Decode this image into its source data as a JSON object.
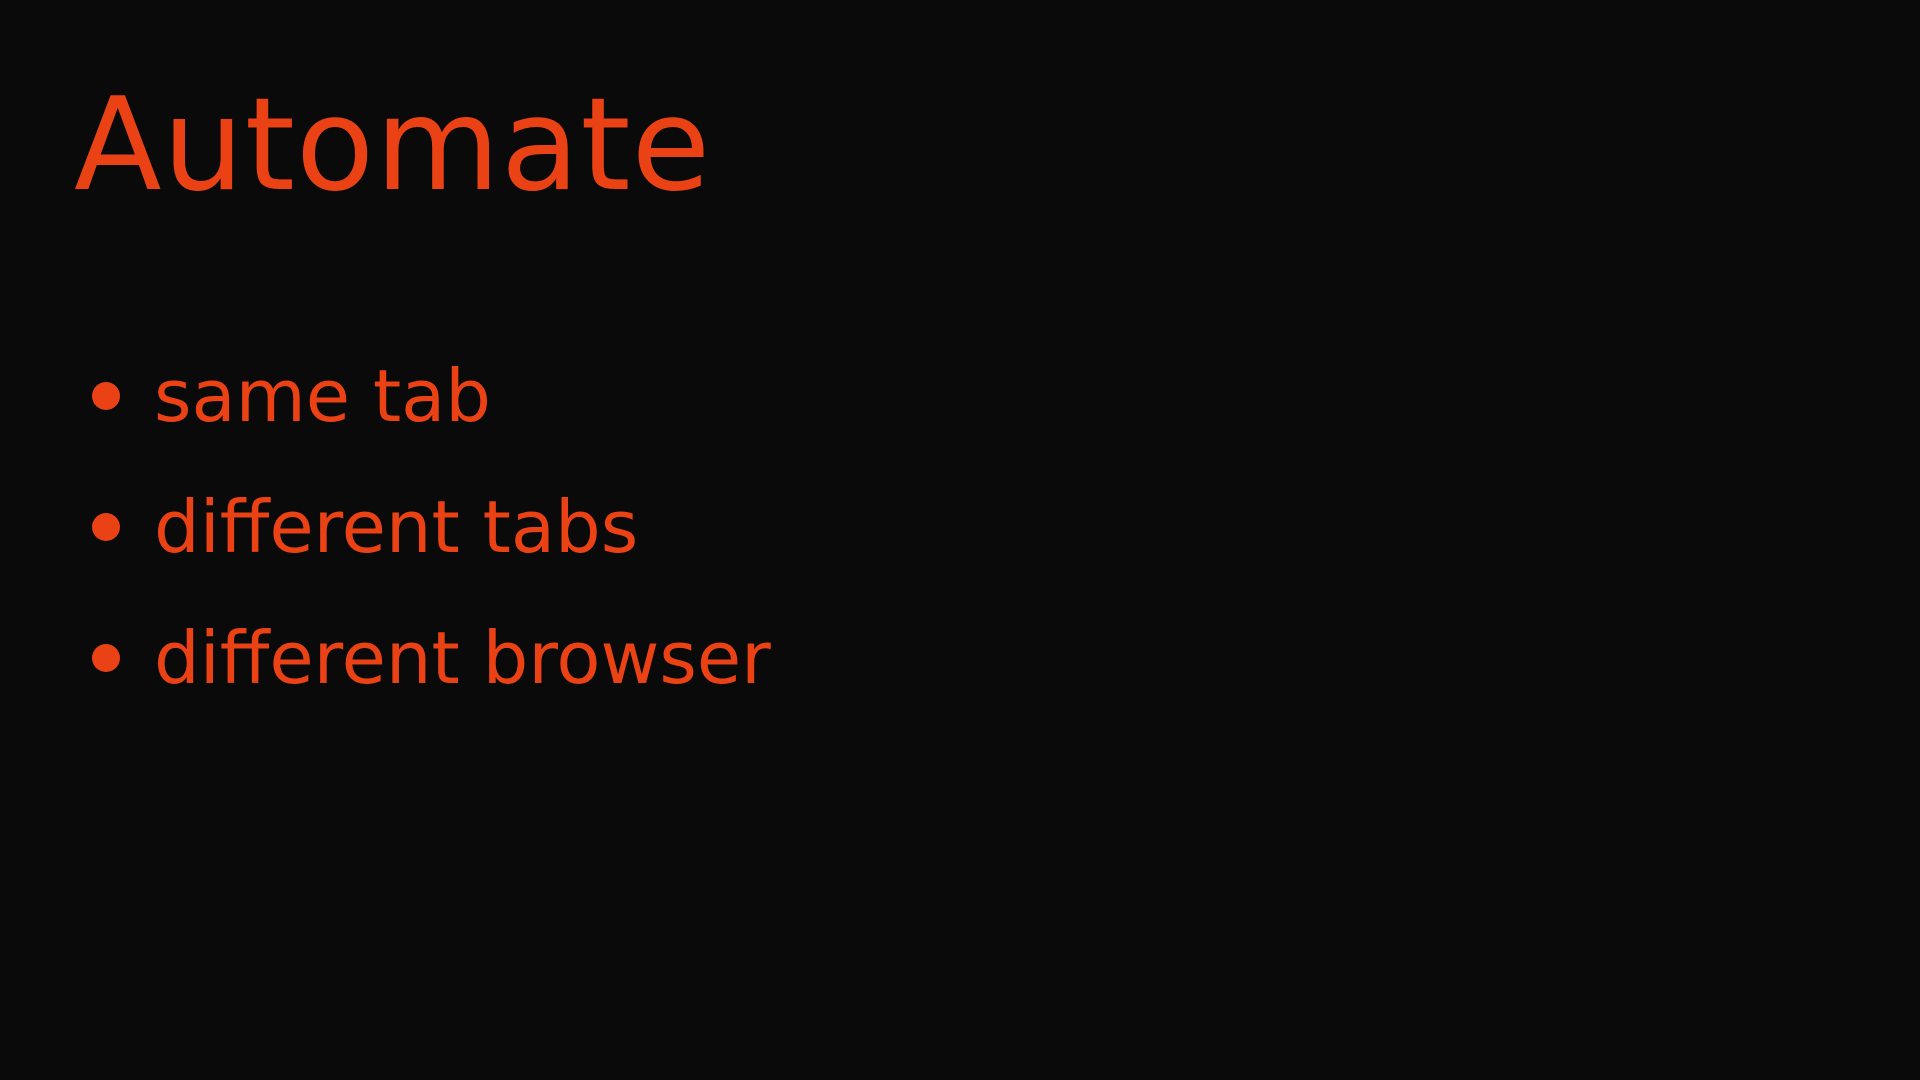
{
  "slide": {
    "title": "Automate",
    "bullets": [
      "same tab",
      "different tabs",
      "different browser"
    ]
  },
  "colors": {
    "background": "#0a0a0a",
    "accent": "#ea4214"
  },
  "icons": {
    "bullet": "bullet-dot-icon"
  }
}
